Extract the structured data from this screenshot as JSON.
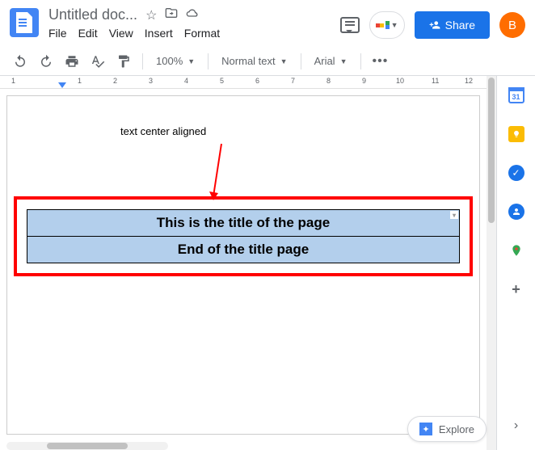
{
  "header": {
    "doc_title": "Untitled doc...",
    "menus": [
      "File",
      "Edit",
      "View",
      "Insert",
      "Format"
    ],
    "share_label": "Share",
    "avatar_letter": "B"
  },
  "toolbar": {
    "zoom": "100%",
    "style": "Normal text",
    "font": "Arial"
  },
  "ruler": {
    "numbers": [
      "1",
      "1",
      "2",
      "3",
      "4",
      "5",
      "6",
      "7",
      "8",
      "9",
      "10",
      "11",
      "12"
    ]
  },
  "annotation": "text center aligned",
  "table": {
    "row1": "This is the title of the page",
    "row2": "End of the title page"
  },
  "sidepanel": {
    "calendar_day": "31"
  },
  "explore_label": "Explore"
}
